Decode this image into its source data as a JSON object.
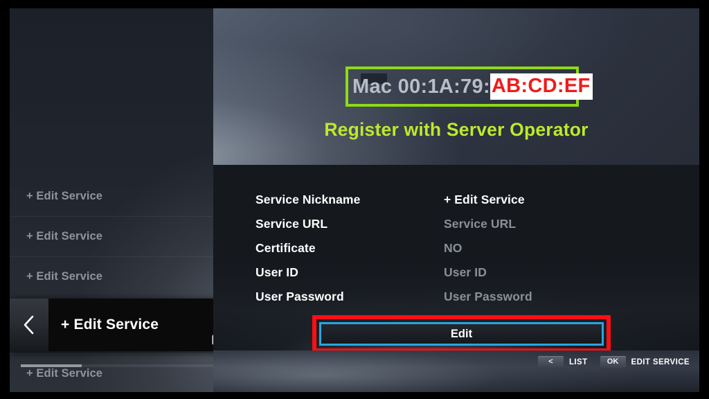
{
  "sidebar": {
    "items": [
      {
        "label": "+ Edit Service"
      },
      {
        "label": "+ Edit Service"
      },
      {
        "label": "+ Edit Service"
      },
      {
        "label": "+ Edit Service"
      }
    ],
    "selected": {
      "label": "+ Edit Service",
      "back_icon": "chevron-left-icon",
      "device_icon": "monitor-icon"
    }
  },
  "hero": {
    "mac_label": "Mac 00:1A:79:",
    "mac_suffix": "AB:CD:EF",
    "subtitle": "Register with Server Operator",
    "highlight_box_color": "#8fd917",
    "suffix_text_color": "#ef1b1b",
    "suffix_bg_color": "#ffffff",
    "subtitle_color": "#bcea2b"
  },
  "form": {
    "rows": [
      {
        "label": "Service Nickname",
        "value": "+ Edit Service",
        "emphasis": "strong"
      },
      {
        "label": "Service URL",
        "value": "Service URL",
        "emphasis": "muted"
      },
      {
        "label": "Certificate",
        "value": "NO",
        "emphasis": "muted"
      },
      {
        "label": "User ID",
        "value": "User ID",
        "emphasis": "muted"
      },
      {
        "label": "User Password",
        "value": "User Password",
        "emphasis": "muted"
      }
    ],
    "edit_button": {
      "label": "Edit",
      "focus_border_color": "#2aa5e0",
      "callout_border_color": "#fb0f15"
    }
  },
  "bottom_bar": {
    "hints": [
      {
        "key": "<",
        "label": "LIST"
      },
      {
        "key": "OK",
        "label": "EDIT SERVICE"
      }
    ]
  }
}
